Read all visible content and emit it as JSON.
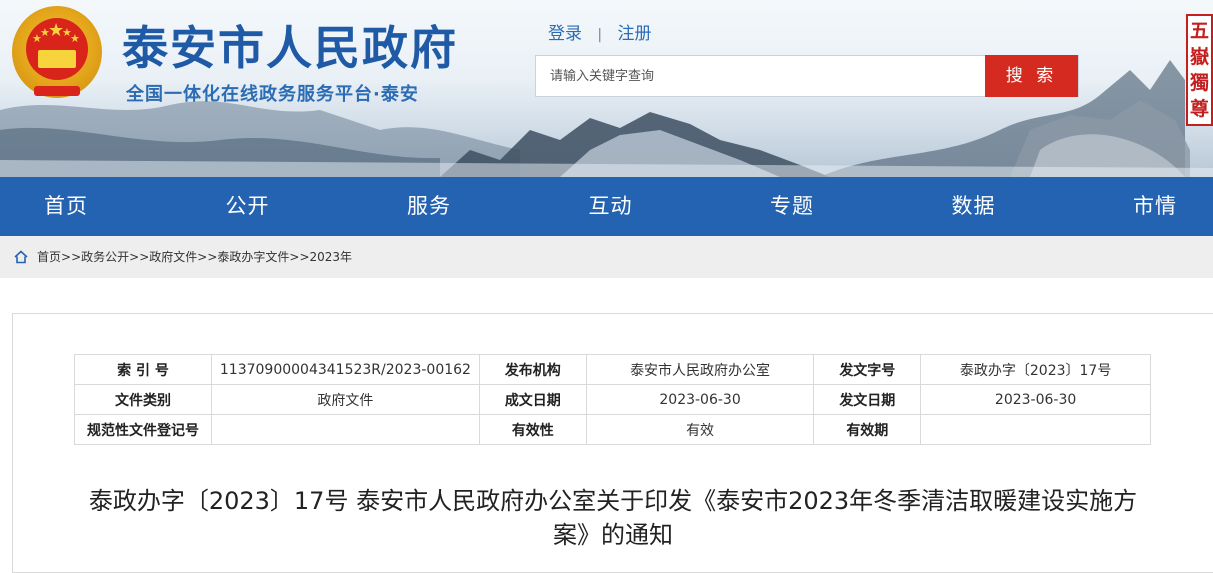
{
  "header": {
    "title": "泰安市人民政府",
    "subtitle": "全国一体化在线政务服务平台·泰安",
    "login": "登录",
    "auth_separator": "|",
    "register": "注册",
    "search_placeholder": "请输入关键字查询",
    "search_button": "搜 索",
    "seal_text": "五嶽獨尊"
  },
  "nav": {
    "items": [
      "首页",
      "公开",
      "服务",
      "互动",
      "专题",
      "数据",
      "市情"
    ]
  },
  "breadcrumb": {
    "items": [
      "首页",
      "政务公开",
      "政府文件",
      "泰政办字文件",
      "2023年"
    ],
    "separator": ">>"
  },
  "meta_table": {
    "rows": [
      [
        {
          "label": "索 引 号",
          "value": "11370900004341523R/2023-00162"
        },
        {
          "label": "发布机构",
          "value": "泰安市人民政府办公室"
        },
        {
          "label": "发文字号",
          "value": "泰政办字〔2023〕17号"
        }
      ],
      [
        {
          "label": "文件类别",
          "value": "政府文件"
        },
        {
          "label": "成文日期",
          "value": "2023-06-30"
        },
        {
          "label": "发文日期",
          "value": "2023-06-30"
        }
      ],
      [
        {
          "label": "规范性文件登记号",
          "value": ""
        },
        {
          "label": "有效性",
          "value": "有效"
        },
        {
          "label": "有效期",
          "value": ""
        }
      ]
    ]
  },
  "document": {
    "title": "泰政办字〔2023〕17号 泰安市人民政府办公室关于印发《泰安市2023年冬季清洁取暖建设实施方案》的通知"
  },
  "colors": {
    "brand_blue": "#2463b1",
    "title_blue": "#1f5aa6",
    "search_red": "#d42a1f",
    "seal_red": "#c41e1e"
  }
}
